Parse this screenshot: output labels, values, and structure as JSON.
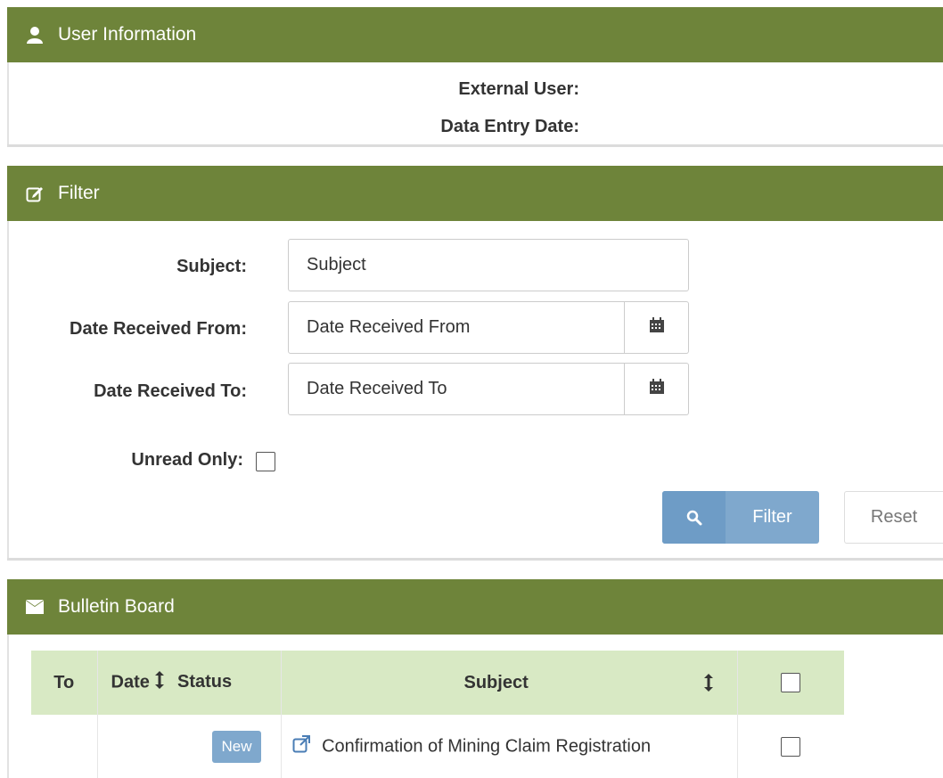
{
  "user_info": {
    "title": "User Information",
    "external_user_label": "External User:",
    "data_entry_date_label": "Data Entry Date:"
  },
  "filter": {
    "title": "Filter",
    "subject_label": "Subject:",
    "subject_placeholder": "Subject",
    "date_from_label": "Date Received From:",
    "date_from_placeholder": "Date Received From",
    "date_to_label": "Date Received To:",
    "date_to_placeholder": "Date Received To",
    "unread_label": "Unread Only:",
    "filter_button": "Filter",
    "reset_button": "Reset"
  },
  "bulletin": {
    "title": "Bulletin Board",
    "columns": {
      "to": "To",
      "date": "Date",
      "status": "Status",
      "subject": "Subject"
    },
    "rows": [
      {
        "to": "",
        "date": "",
        "status": "New",
        "subject": "Confirmation of Mining Claim Registration"
      }
    ]
  },
  "colors": {
    "header_green": "#6e843a",
    "table_header": "#d8e9c4",
    "primary_button": "#7fa8cd",
    "badge": "#7fa8cd"
  },
  "icons": {
    "user_info": "user-icon",
    "filter": "edit-icon",
    "bulletin": "envelope-icon",
    "calendar": "calendar-icon",
    "search": "search-icon",
    "sort": "sort-icon",
    "external_link": "external-link-icon"
  }
}
